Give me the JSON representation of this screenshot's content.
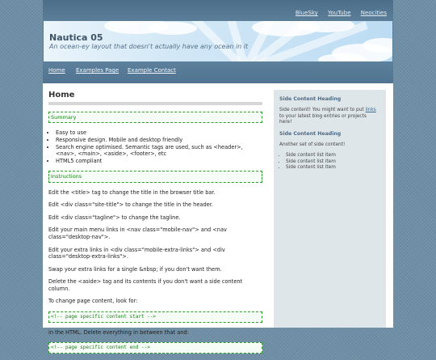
{
  "top_links": [
    "BlueSky",
    "YouTube",
    "Neocities"
  ],
  "header": {
    "title": "Nautica 05",
    "tagline": "An ocean-ey layout that doesn't actually have any ocean in it"
  },
  "nav": [
    "Home",
    "Examples Page",
    "Example Contact"
  ],
  "content": {
    "page_title": "Home",
    "summary_label": "Summary",
    "summary_items": [
      "Easy to use",
      "Responsive design. Mobile and desktop friendly",
      "Search engine optimised. Semantic tags are used, such as <header>, <nav>, <main>, <aside>, <footer>, etc",
      "HTML5 compliant"
    ],
    "instructions_label": "Instructions",
    "paragraphs": [
      "Edit the <title> tag to change the title in the browser title bar.",
      "Edit <div class=\"site-title\"> to change the title in the header.",
      "Edit <div class=\"tagline\"> to change the tagline.",
      "Edit your main menu links in <nav class=\"mobile-nav\"> and <nav class=\"desktop-nav\">.",
      "Edit your extra links in <div class=\"mobile-extra-links\"> and <div class=\"desktop-extra-links\">.",
      "Swap your extra links for a single &nbsp; if you don't want them.",
      "Delete the <aside> tag and its contents if you don't want a side content column.",
      "To change page content, look for:"
    ],
    "code_start": "<!-- page specific content start -->",
    "between_text": "in the HTML. Delete everything in between that and:",
    "code_end": "<!-- page specific content end -->"
  },
  "sidebar": {
    "heading1": "Side Content Heading",
    "text1_before": "Side content! You might want to put ",
    "text1_link": "links",
    "text1_after": " to your latest blog entries or projects here!",
    "heading2": "Side Content Heading",
    "text2": "Another set of side content!",
    "items": [
      "Side content list item",
      "Side content list item",
      "Side content list item"
    ]
  }
}
